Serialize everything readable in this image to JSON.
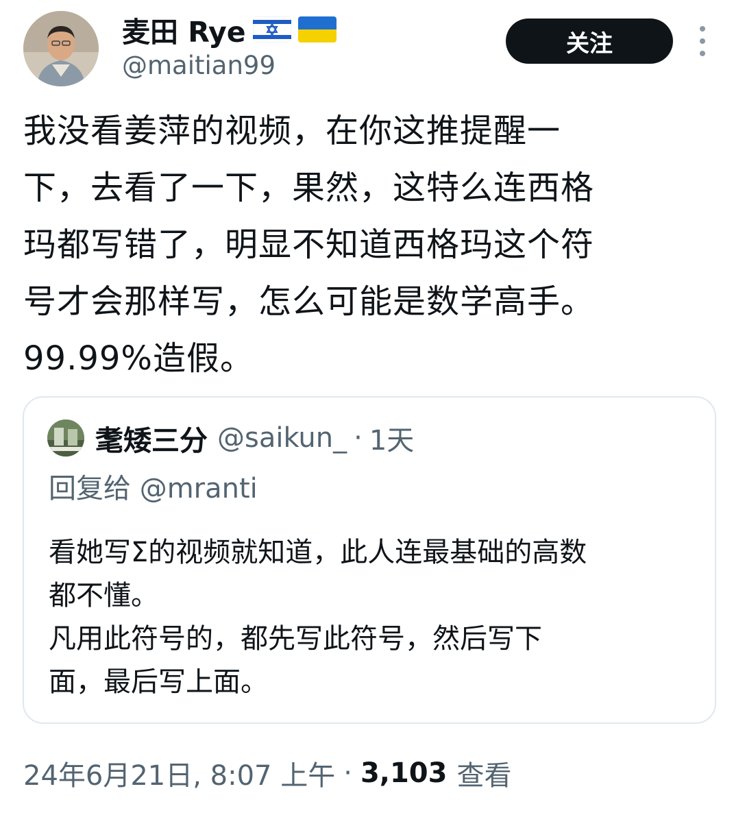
{
  "author": {
    "display_name": "麦田 Rye",
    "handle": "@maitian99",
    "flags": [
      "israel-flag",
      "ukraine-flag"
    ]
  },
  "actions": {
    "follow_label": "关注",
    "more_icon": "more-vertical-icon"
  },
  "tweet": {
    "lines": [
      "我没看姜萍的视频，在你这推提醒一",
      "下，去看了一下，果然，这特么连西格",
      "玛都写错了，明显不知道西格玛这个符",
      "号才会那样写，怎么可能是数学高手。",
      "99.99%造假。"
    ]
  },
  "quote": {
    "display_name": "耄矮三分",
    "handle": "@saikun_",
    "separator": "·",
    "time": "1天",
    "reply_prefix": "回复给",
    "reply_handle": "@mranti",
    "lines": [
      "看她写Σ的视频就知道，此人连最基础的高数",
      "都不懂。",
      "凡用此符号的，都先写此符号，然后写下",
      "面，最后写上面。"
    ]
  },
  "meta": {
    "timestamp": "24年6月21日, 8:07 上午",
    "separator": "·",
    "views_count": "3,103",
    "views_label": "查看"
  },
  "colors": {
    "text_primary": "#0f1419",
    "text_secondary": "#536471",
    "border": "#e1e8ed",
    "button_bg": "#0f1419"
  }
}
